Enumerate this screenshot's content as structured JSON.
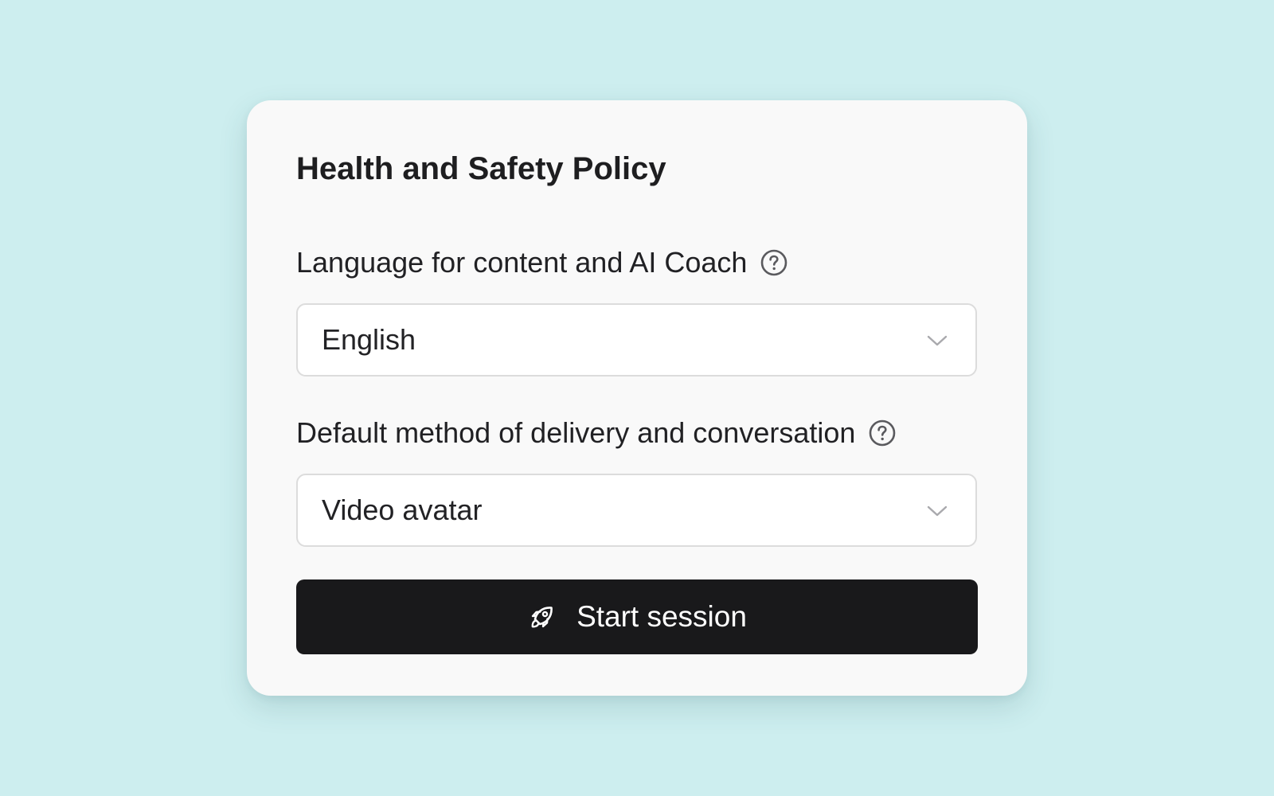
{
  "card": {
    "title": "Health and Safety Policy",
    "language_field": {
      "label": "Language for content and AI Coach",
      "help_icon": "question-circle-icon",
      "selected_value": "English",
      "dropdown_icon": "chevron-down-icon"
    },
    "delivery_field": {
      "label": "Default method of delivery and conversation",
      "help_icon": "question-circle-icon",
      "selected_value": "Video avatar",
      "dropdown_icon": "chevron-down-icon"
    },
    "start_button": {
      "label": "Start session",
      "icon": "rocket-icon"
    }
  },
  "colors": {
    "page_background": "#cdeeef",
    "card_background": "#f9f9f9",
    "primary_button": "#19191b",
    "primary_button_text": "#ffffff",
    "select_border": "#dcdcdc"
  }
}
